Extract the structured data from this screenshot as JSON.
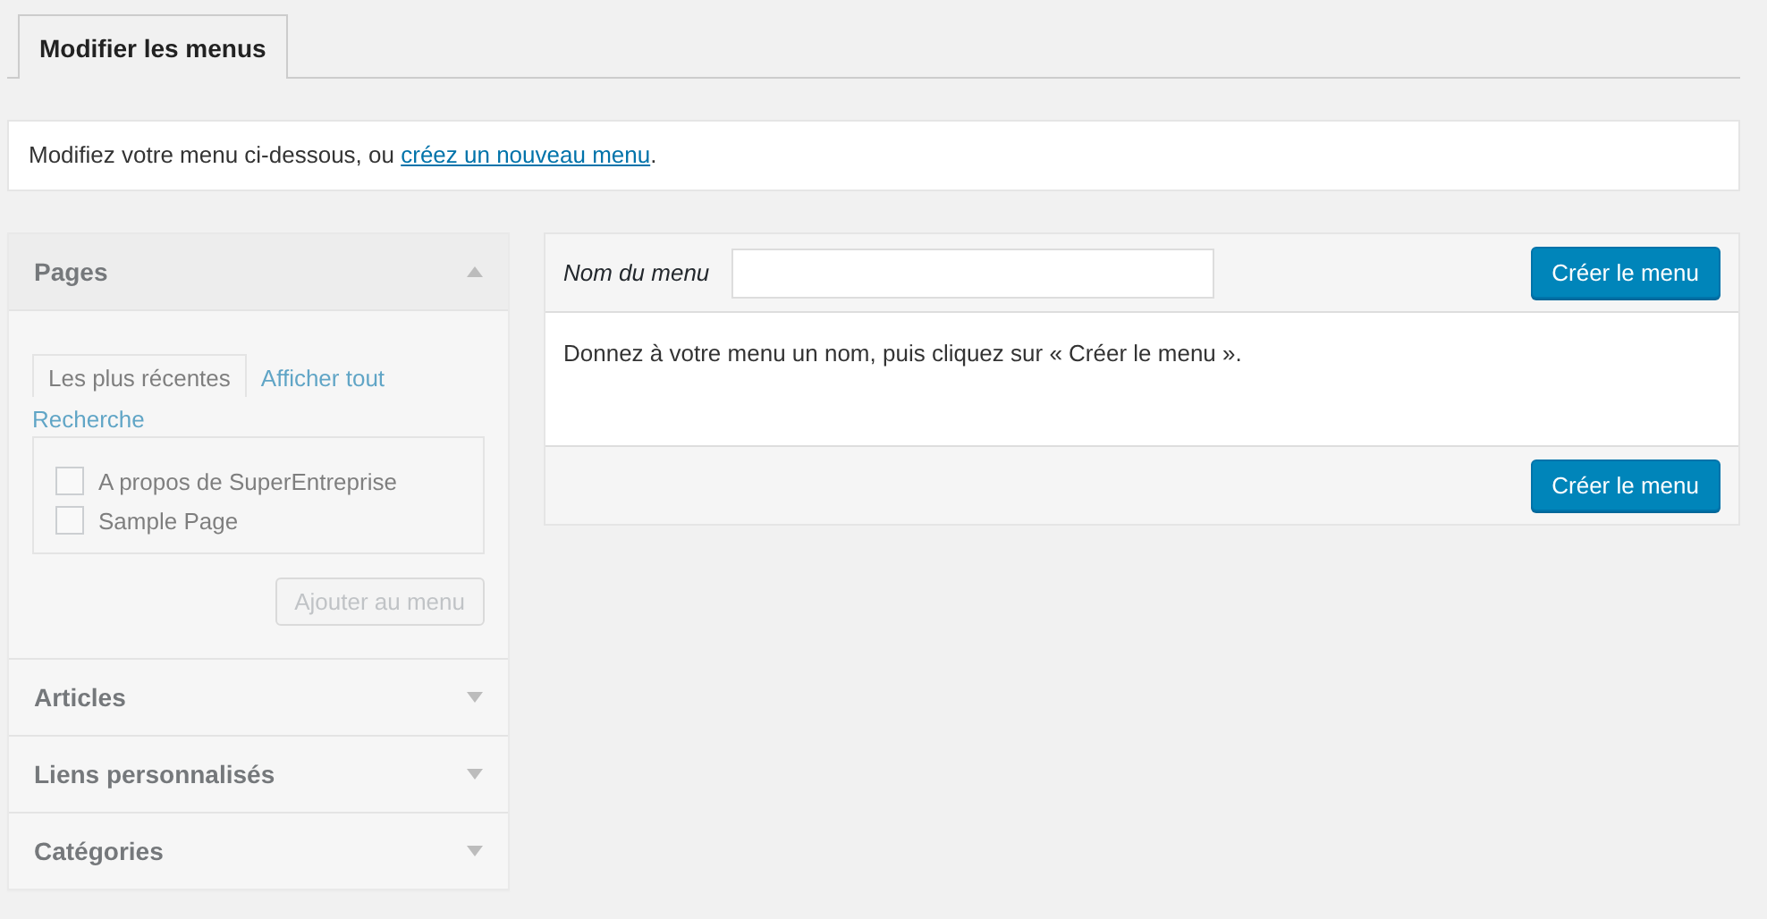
{
  "tabs": [
    {
      "label": "Modifier les menus",
      "selected": true
    }
  ],
  "notice": {
    "text_before": "Modifiez votre menu ci-dessous, ou ",
    "link": "créez un nouveau menu",
    "text_after": "."
  },
  "sidebar": {
    "disabled": true,
    "sections": [
      {
        "title": "Pages",
        "expanded": true,
        "tabs": [
          {
            "label": "Les plus récentes",
            "selected": true
          },
          {
            "label": "Afficher tout",
            "selected": false
          },
          {
            "label": "Recherche",
            "selected": false
          }
        ],
        "items": [
          {
            "label": "A propos de SuperEntreprise",
            "checked": false
          },
          {
            "label": "Sample Page",
            "checked": false
          }
        ],
        "button": "Ajouter au menu"
      },
      {
        "title": "Articles",
        "expanded": false
      },
      {
        "title": "Liens personnalisés",
        "expanded": false
      },
      {
        "title": "Catégories",
        "expanded": false
      }
    ]
  },
  "editor": {
    "name_label": "Nom du menu",
    "top_button": "Créer le menu",
    "instructions": "Donnez à votre menu un nom, puis cliquez sur « Créer le menu ».",
    "bottom_button": "Créer le menu"
  }
}
